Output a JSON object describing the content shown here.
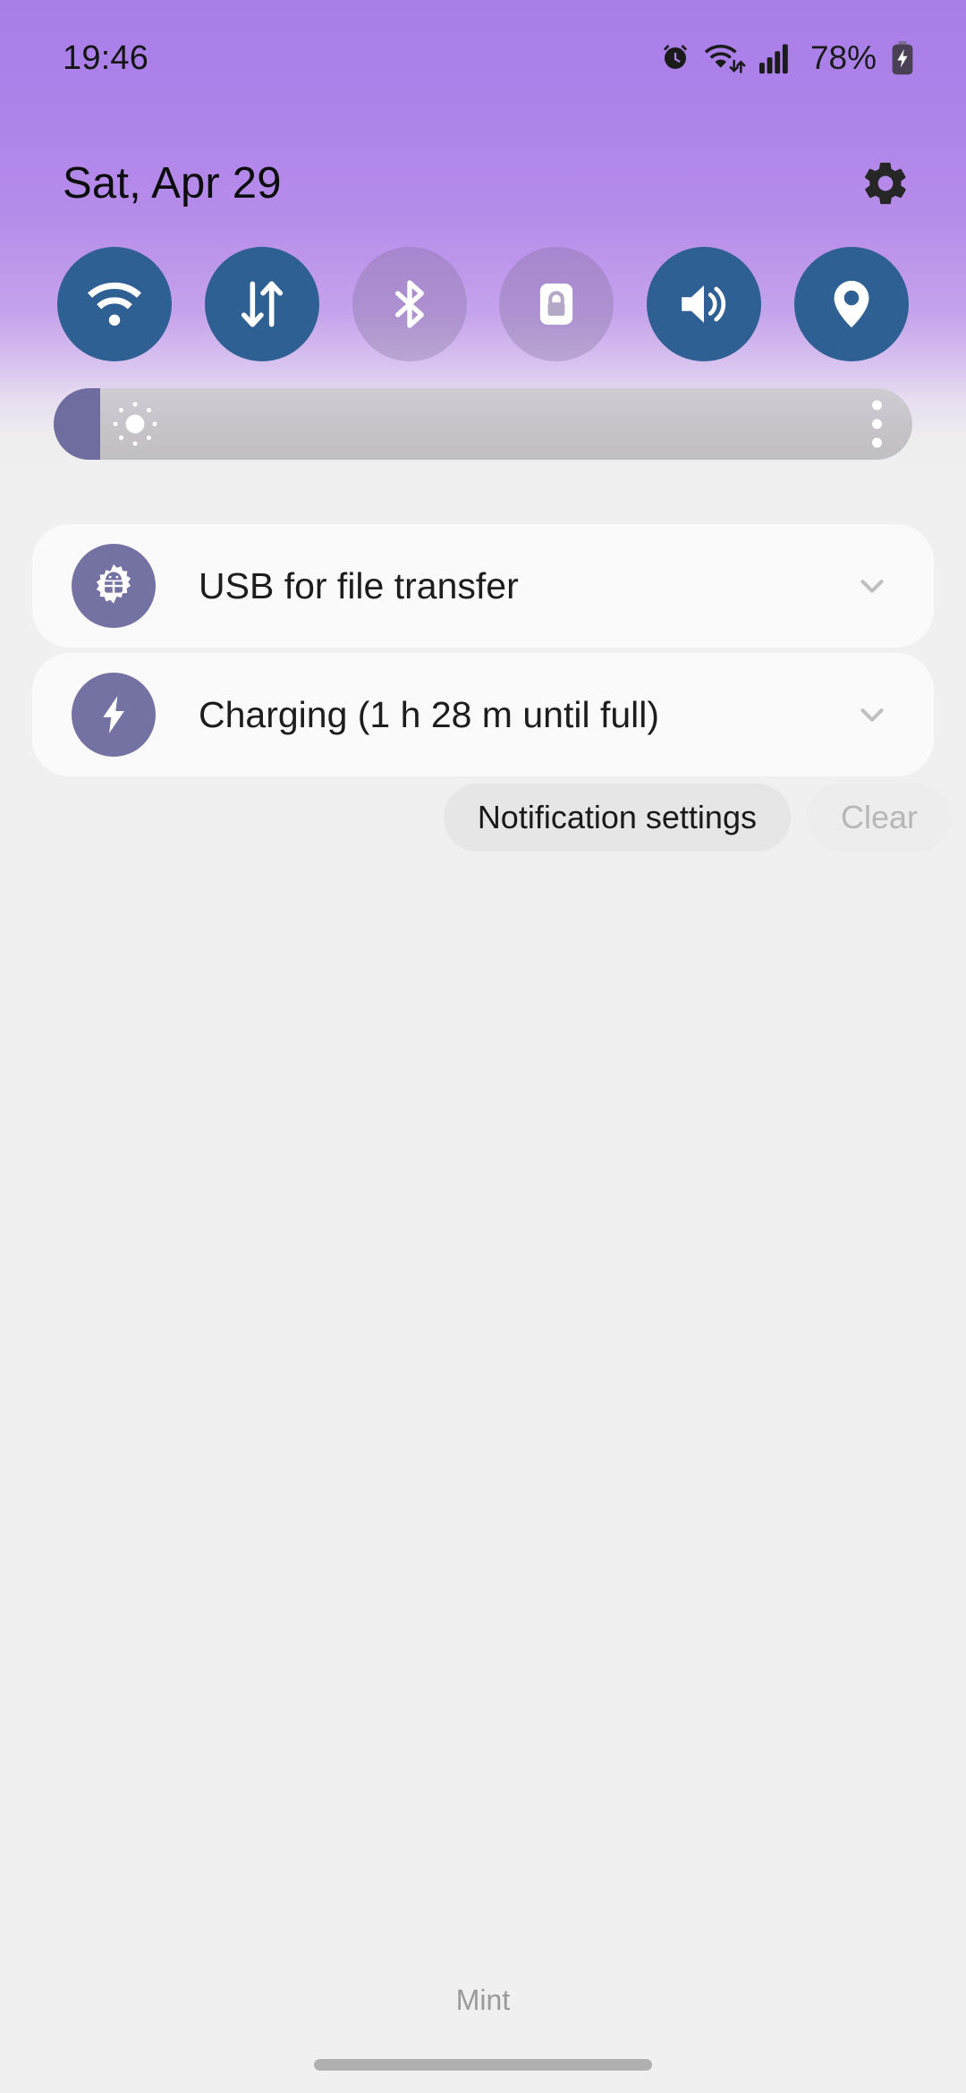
{
  "status_bar": {
    "clock": "19:46",
    "battery_percent": "78%",
    "icons": [
      {
        "name": "alarm-icon"
      },
      {
        "name": "wifi-data-icon"
      },
      {
        "name": "signal-bars-icon"
      },
      {
        "name": "battery-charging-icon"
      }
    ]
  },
  "header": {
    "date": "Sat, Apr 29",
    "settings_icon": "gear-icon"
  },
  "quick_settings": {
    "tiles": [
      {
        "name": "wifi",
        "icon": "wifi-icon",
        "state": "on"
      },
      {
        "name": "mobiledata",
        "icon": "data-arrows-icon",
        "state": "on"
      },
      {
        "name": "bluetooth",
        "icon": "bluetooth-icon",
        "state": "off"
      },
      {
        "name": "autorotate",
        "icon": "rotation-lock-icon",
        "state": "off"
      },
      {
        "name": "sound",
        "icon": "volume-icon",
        "state": "on"
      },
      {
        "name": "location",
        "icon": "location-pin-icon",
        "state": "on"
      }
    ]
  },
  "brightness": {
    "icon": "brightness-sun-icon",
    "menu_icon": "overflow-menu-icon",
    "level_percent": 5
  },
  "notifications": [
    {
      "icon": "android-gear-icon",
      "title": "USB for file transfer",
      "expand_icon": "chevron-down-icon"
    },
    {
      "icon": "lightning-bolt-icon",
      "title": "Charging (1 h 28 m until full)",
      "expand_icon": "chevron-down-icon"
    }
  ],
  "actions": {
    "notification_settings_label": "Notification settings",
    "clear_label": "Clear"
  },
  "footer": {
    "carrier": "Mint"
  },
  "colors": {
    "shade_top": "#a97ee8",
    "shade_bottom": "#f0f0f0",
    "tile_active": "#2e6093",
    "tile_inactive": "rgba(125,110,150,0.32)",
    "notif_icon_purple": "#7472a3",
    "slider_fill": "#6f6da0"
  }
}
